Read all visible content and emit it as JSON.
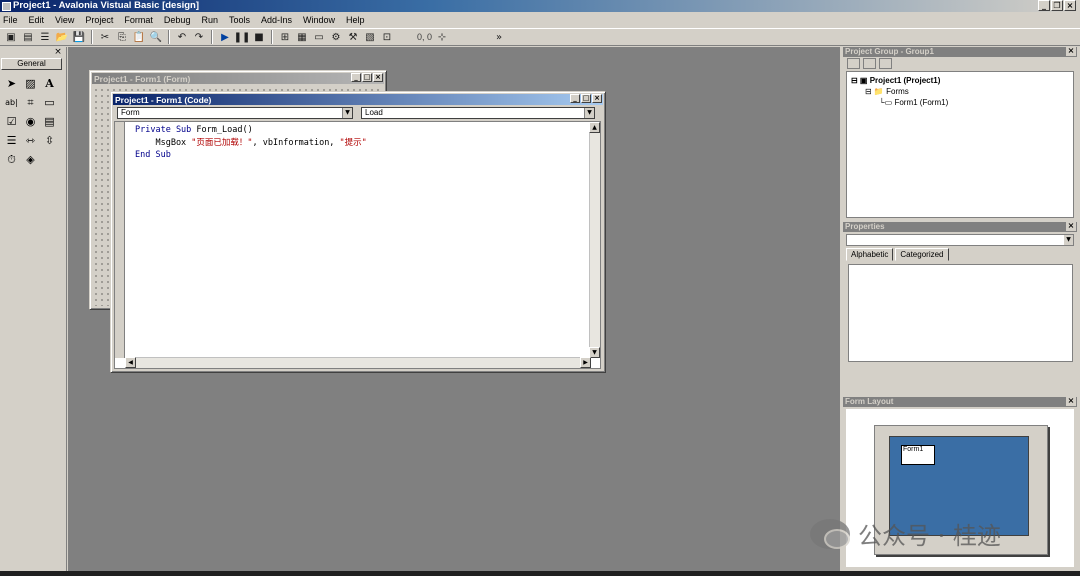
{
  "window": {
    "title": "Project1 - Avalonia Vistual Basic [design]"
  },
  "menu": [
    "File",
    "Edit",
    "View",
    "Project",
    "Format",
    "Debug",
    "Run",
    "Tools",
    "Add-Ins",
    "Window",
    "Help"
  ],
  "toolbar": {
    "coords": "0, 0"
  },
  "toolbox": {
    "tab_label": "General"
  },
  "form_window": {
    "title": "Project1 - Form1 (Form)"
  },
  "code_window": {
    "title": "Project1 - Form1 (Code)",
    "object_combo": "Form",
    "procedure_combo": "Load",
    "code": {
      "line1_kw1": "Private Sub",
      "line1_rest": " Form_Load()",
      "line2_pre": "    MsgBox ",
      "line2_str1": "\"页面已加载！\"",
      "line2_mid": ", vbInformation, ",
      "line2_str2": "\"提示\"",
      "line3_kw": "End Sub"
    }
  },
  "project_panel": {
    "title": "Project Group - Group1",
    "tree": {
      "project": "Project1 (Project1)",
      "folder": "Forms",
      "form": "Form1 (Form1)"
    }
  },
  "properties_panel": {
    "title": "Properties",
    "tabs": [
      "Alphabetic",
      "Categorized"
    ]
  },
  "layout_panel": {
    "title": "Form Layout",
    "form_label": "Form1"
  },
  "watermark": {
    "text": "公众号 · 桂迹"
  }
}
